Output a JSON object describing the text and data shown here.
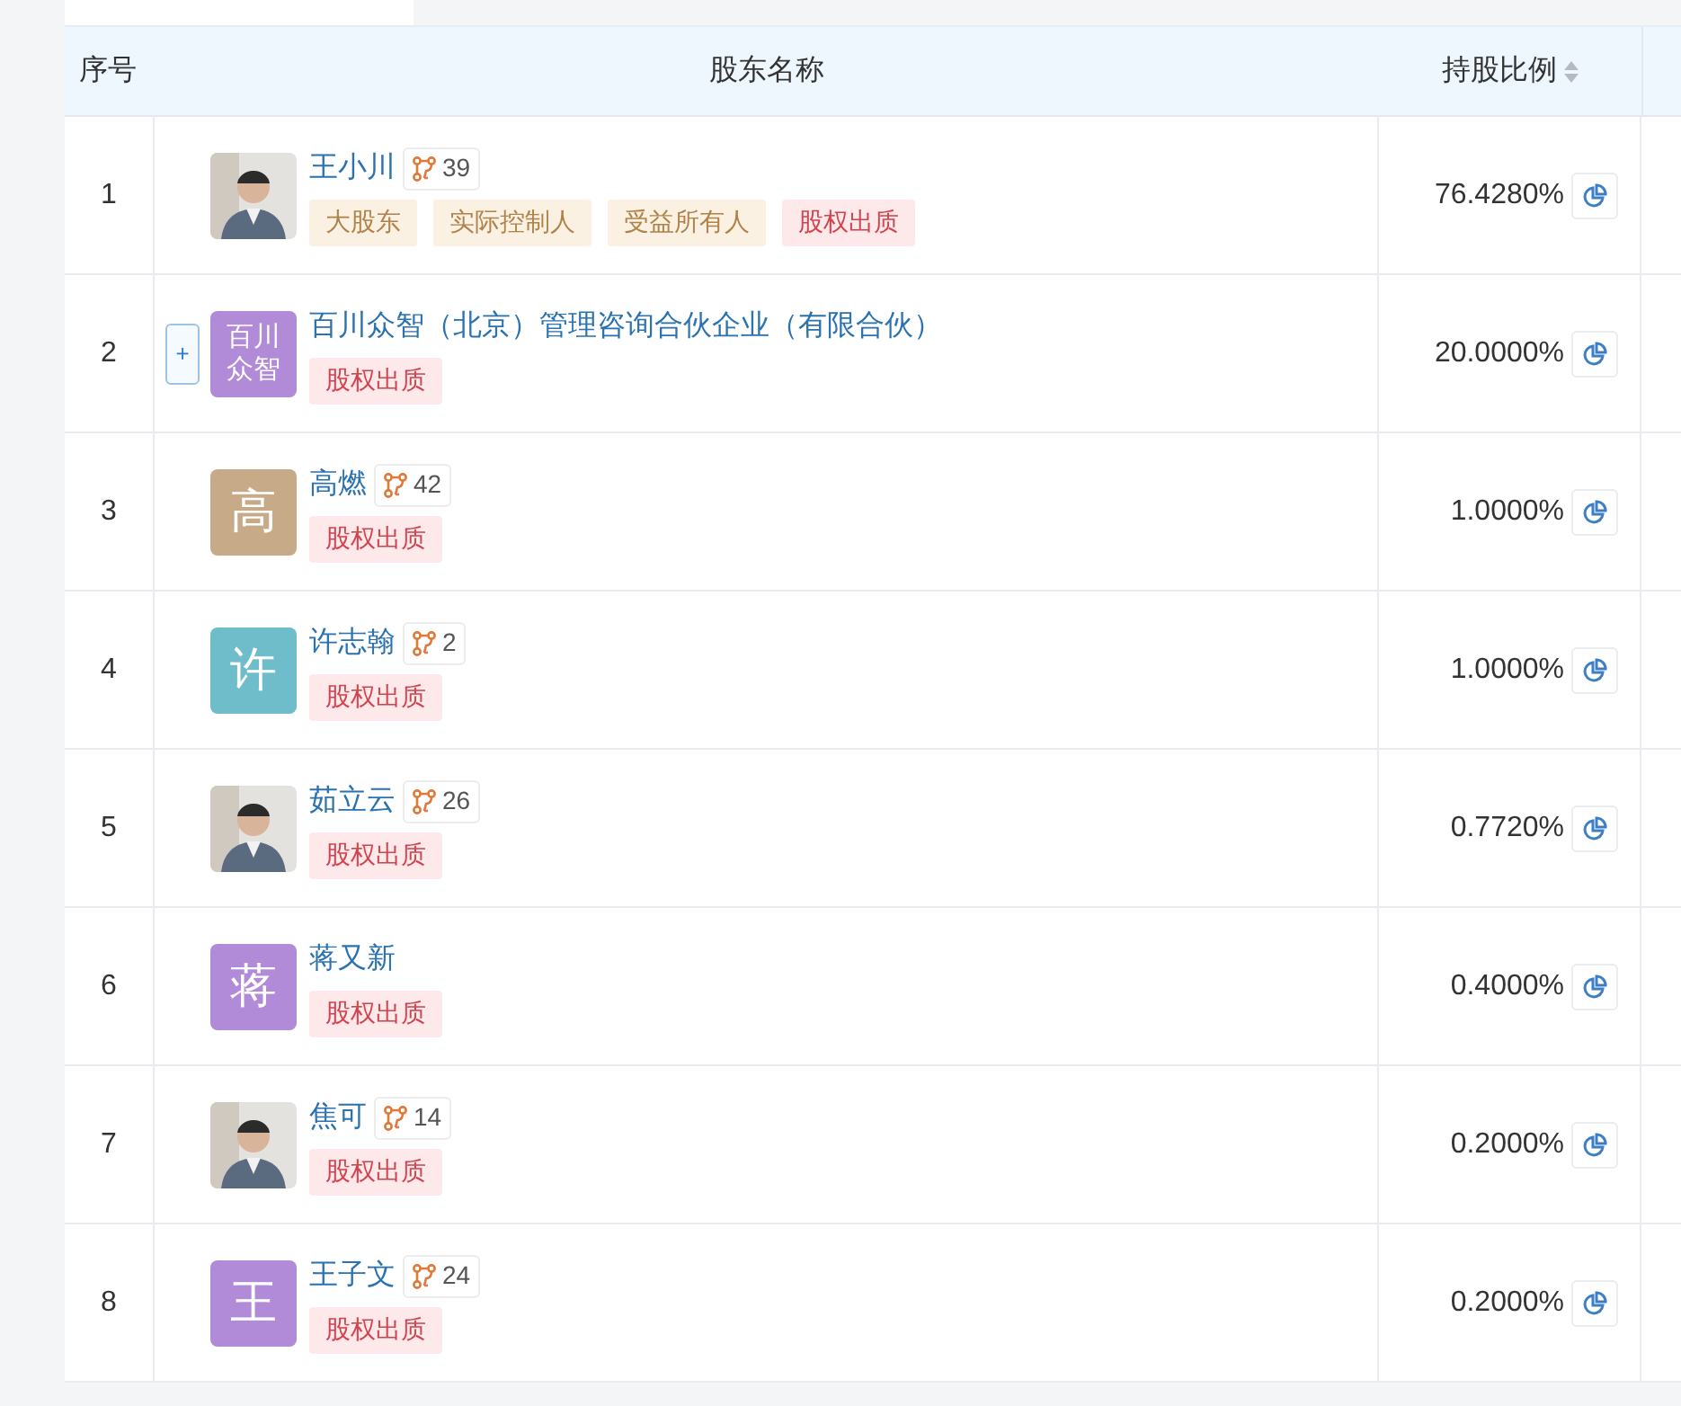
{
  "table": {
    "columns": [
      {
        "label": "序号"
      },
      {
        "label": "股东名称"
      },
      {
        "label": "持股比例",
        "sortable": true
      }
    ],
    "rows": [
      {
        "index": "1",
        "name": "王小川",
        "links": "39",
        "tags": [
          {
            "label": "大股东",
            "kind": "role"
          },
          {
            "label": "实际控制人",
            "kind": "role"
          },
          {
            "label": "受益所有人",
            "kind": "role"
          },
          {
            "label": "股权出质",
            "kind": "risk"
          }
        ],
        "ratio": "76.4280%"
      },
      {
        "index": "2",
        "avatar": {
          "kind": "text",
          "text": "百川众智",
          "color": "#b18ad8"
        },
        "name": "百川众智（北京）管理咨询合伙企业（有限合伙）",
        "expand_symbol": "+",
        "tags": [
          {
            "label": "股权出质",
            "kind": "risk"
          }
        ],
        "ratio": "20.0000%"
      },
      {
        "index": "3",
        "avatar": {
          "kind": "text",
          "text": "高",
          "color": "#c7aa88"
        },
        "name": "高燃",
        "links": "42",
        "tags": [
          {
            "label": "股权出质",
            "kind": "risk"
          }
        ],
        "ratio": "1.0000%"
      },
      {
        "index": "4",
        "avatar": {
          "kind": "text",
          "text": "许",
          "color": "#6fbccb"
        },
        "name": "许志翰",
        "links": "2",
        "tags": [
          {
            "label": "股权出质",
            "kind": "risk"
          }
        ],
        "ratio": "1.0000%"
      },
      {
        "index": "5",
        "name": "茹立云",
        "links": "26",
        "tags": [
          {
            "label": "股权出质",
            "kind": "risk"
          }
        ],
        "ratio": "0.7720%"
      },
      {
        "index": "6",
        "avatar": {
          "kind": "text",
          "text": "蒋",
          "color": "#b18ad8"
        },
        "name": "蒋又新",
        "tags": [
          {
            "label": "股权出质",
            "kind": "risk"
          }
        ],
        "ratio": "0.4000%"
      },
      {
        "index": "7",
        "name": "焦可",
        "links": "14",
        "tags": [
          {
            "label": "股权出质",
            "kind": "risk"
          }
        ],
        "ratio": "0.2000%"
      },
      {
        "index": "8",
        "avatar": {
          "kind": "text",
          "text": "王",
          "color": "#b18ad8"
        },
        "name": "王子文",
        "links": "24",
        "tags": [
          {
            "label": "股权出质",
            "kind": "risk"
          }
        ],
        "ratio": "0.2000%"
      }
    ]
  }
}
